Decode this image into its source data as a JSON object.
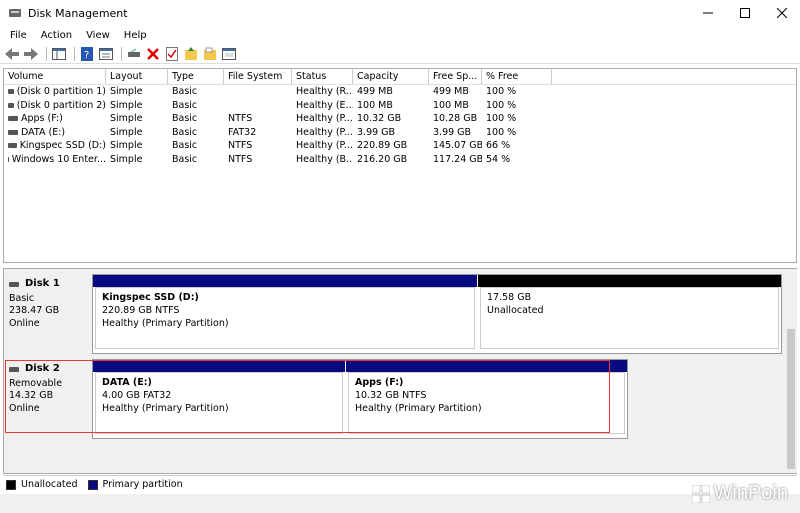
{
  "window": {
    "title": "Disk Management"
  },
  "menu": [
    "File",
    "Action",
    "View",
    "Help"
  ],
  "volumes": {
    "columns": [
      "Volume",
      "Layout",
      "Type",
      "File System",
      "Status",
      "Capacity",
      "Free Sp...",
      "% Free"
    ],
    "rows": [
      [
        "(Disk 0 partition 1)",
        "Simple",
        "Basic",
        "",
        "Healthy (R...",
        "499 MB",
        "499 MB",
        "100 %"
      ],
      [
        "(Disk 0 partition 2)",
        "Simple",
        "Basic",
        "",
        "Healthy (E...",
        "100 MB",
        "100 MB",
        "100 %"
      ],
      [
        "Apps (F:)",
        "Simple",
        "Basic",
        "NTFS",
        "Healthy (P...",
        "10.32 GB",
        "10.28 GB",
        "100 %"
      ],
      [
        "DATA (E:)",
        "Simple",
        "Basic",
        "FAT32",
        "Healthy (P...",
        "3.99 GB",
        "3.99 GB",
        "100 %"
      ],
      [
        "Kingspec SSD (D:)",
        "Simple",
        "Basic",
        "NTFS",
        "Healthy (P...",
        "220.89 GB",
        "145.07 GB",
        "66 %"
      ],
      [
        "Windows 10 Enter...",
        "Simple",
        "Basic",
        "NTFS",
        "Healthy (B...",
        "216.20 GB",
        "117.24 GB",
        "54 %"
      ]
    ]
  },
  "disks": [
    {
      "name": "Disk 1",
      "type": "Basic",
      "size": "238.47 GB",
      "status": "Online",
      "partitions": [
        {
          "name": "Kingspec SSD  (D:)",
          "detail": "220.89 GB NTFS",
          "status": "Healthy (Primary Partition)",
          "color": "#0a0a80"
        },
        {
          "name": "",
          "detail": "17.58 GB",
          "status": "Unallocated",
          "color": "#000000"
        }
      ]
    },
    {
      "name": "Disk 2",
      "type": "Removable",
      "size": "14.32 GB",
      "status": "Online",
      "partitions": [
        {
          "name": "DATA  (E:)",
          "detail": "4.00 GB FAT32",
          "status": "Healthy (Primary Partition)",
          "color": "#0a0a80"
        },
        {
          "name": "Apps  (F:)",
          "detail": "10.32 GB NTFS",
          "status": "Healthy (Primary Partition)",
          "color": "#0a0a80"
        }
      ]
    }
  ],
  "legend": [
    {
      "label": "Unallocated",
      "color": "#000000"
    },
    {
      "label": "Primary partition",
      "color": "#0a0a80"
    }
  ],
  "watermark": "WinPoin"
}
